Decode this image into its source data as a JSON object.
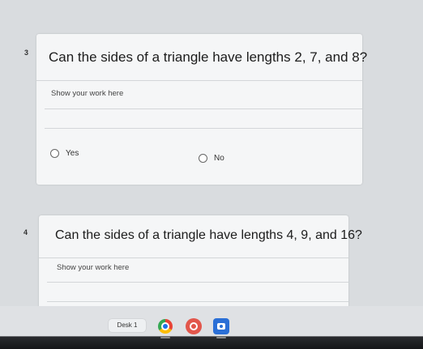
{
  "question3": {
    "number": "3",
    "text": "Can the sides of a triangle have lengths 2, 7, and 8?",
    "work_label": "Show your work here",
    "choices": [
      "Yes",
      "No"
    ]
  },
  "question4": {
    "number": "4",
    "text": "Can the sides of a triangle have lengths 4, 9, and 16?",
    "work_label": "Show your work here"
  },
  "taskbar": {
    "desk_label": "Desk 1",
    "apps": [
      "chrome-icon",
      "photos-icon",
      "camera-icon"
    ],
    "colors": {
      "chrome_blue": "#1a73e8",
      "photos_red": "#e2564b",
      "camera_blue": "#2b6fd6"
    }
  }
}
